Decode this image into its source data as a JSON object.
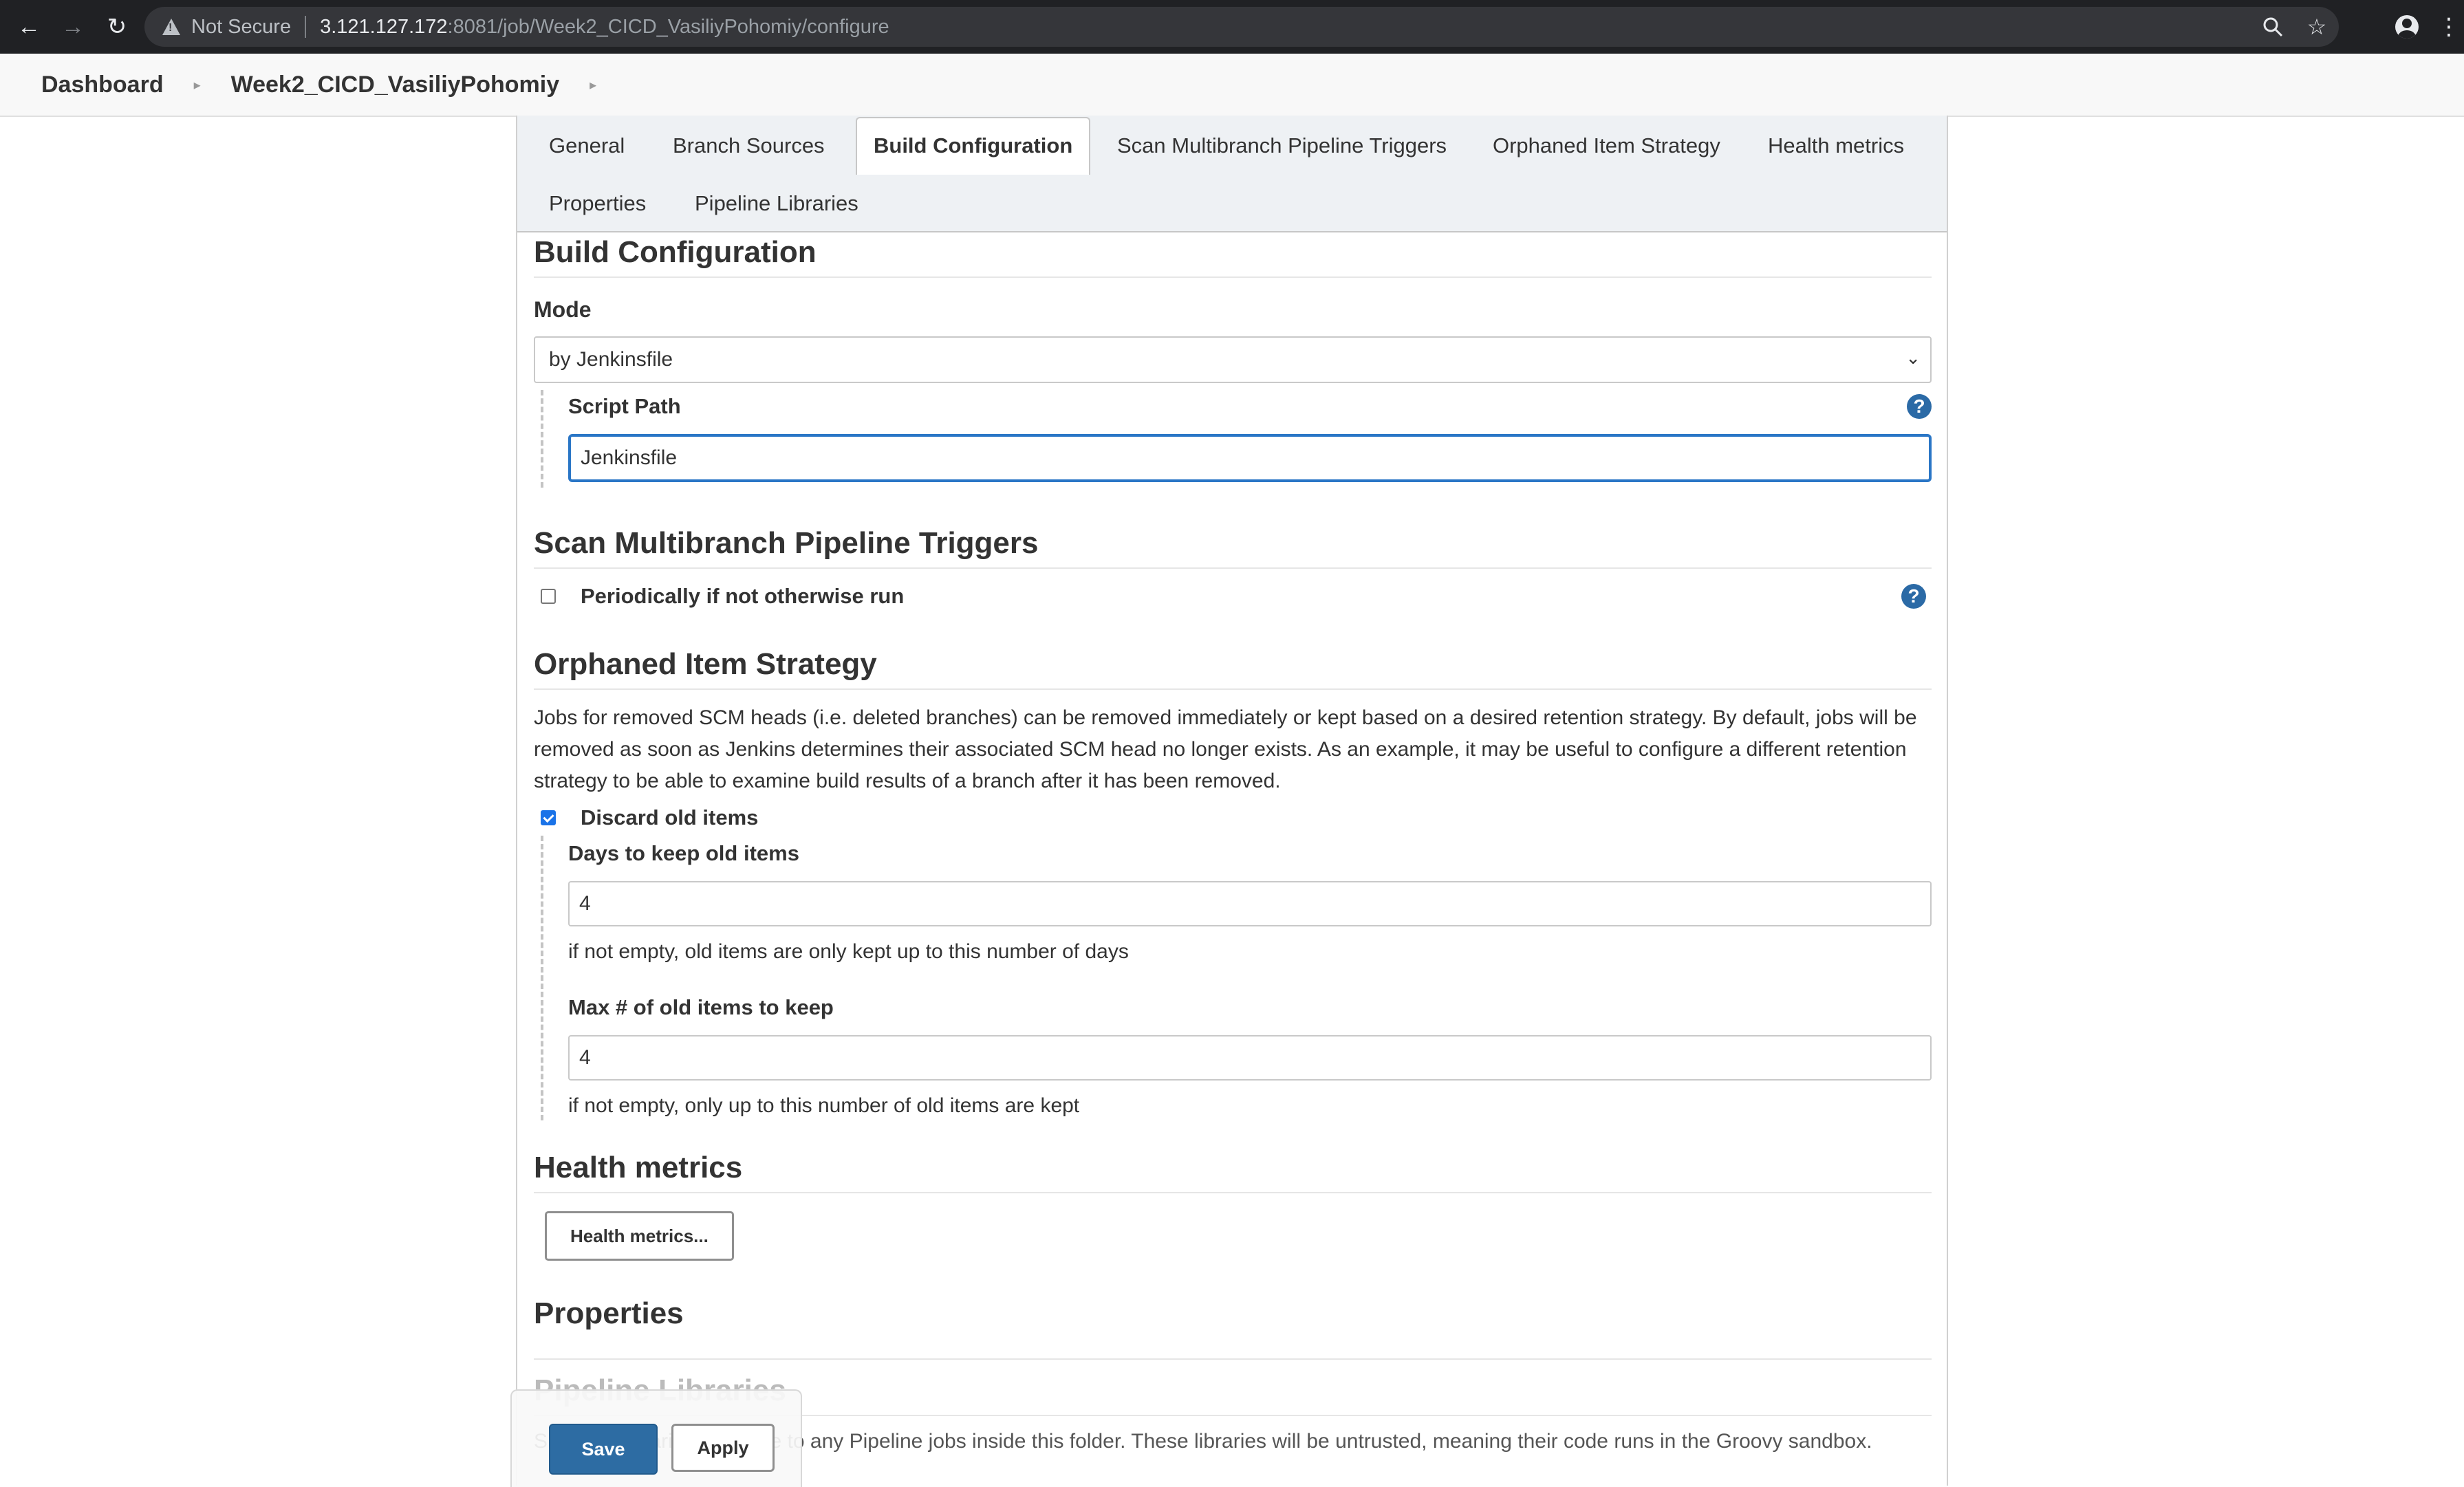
{
  "browser": {
    "security_label": "Not Secure",
    "url_host": "3.121.127.172",
    "url_path": ":8081/job/Week2_CICD_VasiliyPohomiy/configure"
  },
  "breadcrumb": {
    "items": [
      "Dashboard",
      "Week2_CICD_VasiliyPohomiy"
    ]
  },
  "tabs": [
    "General",
    "Branch Sources",
    "Build Configuration",
    "Scan Multibranch Pipeline Triggers",
    "Orphaned Item Strategy",
    "Health metrics",
    "Properties",
    "Pipeline Libraries"
  ],
  "active_tab": "Build Configuration",
  "build_config": {
    "title": "Build Configuration",
    "mode_label": "Mode",
    "mode_value": "by Jenkinsfile",
    "script_path_label": "Script Path",
    "script_path_value": "Jenkinsfile"
  },
  "triggers": {
    "title": "Scan Multibranch Pipeline Triggers",
    "periodic_label": "Periodically if not otherwise run",
    "periodic_checked": false
  },
  "orphaned": {
    "title": "Orphaned Item Strategy",
    "description": "Jobs for removed SCM heads (i.e. deleted branches) can be removed immediately or kept based on a desired retention strategy. By default, jobs will be removed as soon as Jenkins determines their associated SCM head no longer exists. As an example, it may be useful to configure a different retention strategy to be able to examine build results of a branch after it has been removed.",
    "discard_label": "Discard old items",
    "discard_checked": true,
    "days_label": "Days to keep old items",
    "days_value": "4",
    "days_hint": "if not empty, old items are only kept up to this number of days",
    "max_label": "Max # of old items to keep",
    "max_value": "4",
    "max_hint": "if not empty, only up to this number of old items are kept"
  },
  "health": {
    "title": "Health metrics",
    "button_label": "Health metrics..."
  },
  "properties": {
    "title": "Properties"
  },
  "libraries": {
    "title": "Pipeline Libraries",
    "description": "Sharable libraries available to any Pipeline jobs inside this folder. These libraries will be untrusted, meaning their code runs in the Groovy sandbox."
  },
  "actions": {
    "save_label": "Save",
    "apply_label": "Apply"
  },
  "colors": {
    "accent_focus": "#2a76c6",
    "primary_button": "#2d6ca3",
    "help_icon": "#2b6aa6",
    "chrome_bg": "#202124"
  }
}
